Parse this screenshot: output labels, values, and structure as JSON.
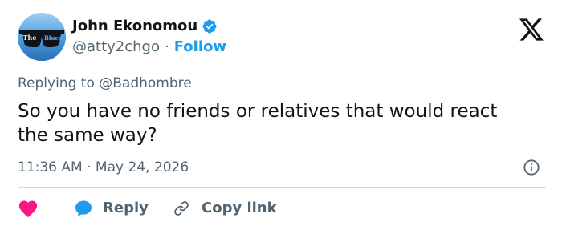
{
  "author": {
    "display_name": "John Ekonomou",
    "handle": "@atty2chgo",
    "separator": "·",
    "follow_label": "Follow",
    "avatar_text_left": "The",
    "avatar_text_right": "Blues"
  },
  "tweet": {
    "replying_to": "Replying to @Badhombre",
    "text": "So you have no friends or relatives that would react the same way?",
    "timestamp": "11:36 AM · May 24, 2026"
  },
  "actions": {
    "reply_label": "Reply",
    "copy_link_label": "Copy link"
  },
  "colors": {
    "accent": "#1d9bf0",
    "like": "#f91880",
    "secondary_text": "#536471",
    "primary_text": "#0f1419"
  },
  "icons": {
    "verified": "verified-badge-icon",
    "brand": "x-logo-icon",
    "info": "info-icon",
    "like": "heart-icon",
    "reply": "speech-bubble-icon",
    "copy_link": "link-icon"
  }
}
